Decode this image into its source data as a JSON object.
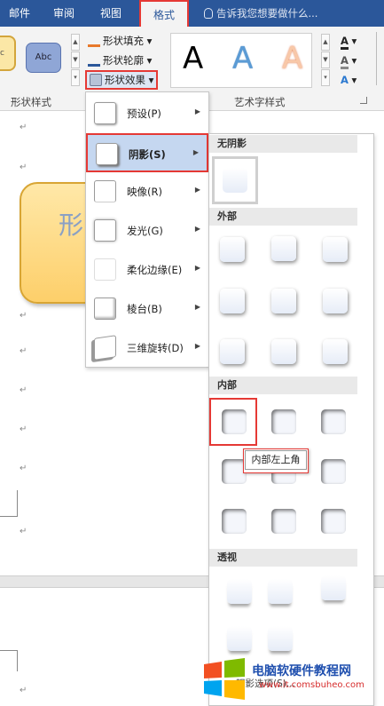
{
  "tabs": [
    {
      "label": "邮件"
    },
    {
      "label": "审阅"
    },
    {
      "label": "视图"
    },
    {
      "label": "格式"
    }
  ],
  "tellme": "告诉我您想要做什么...",
  "ribbon": {
    "style_sample": "Abc",
    "fill": "形状填充",
    "outline": "形状轮廓",
    "effects": "形状效果",
    "shape_styles_label": "形状样式",
    "wordart_label": "艺术字样式",
    "wordart_letter": "A"
  },
  "document": {
    "shape_text": "形"
  },
  "effects_menu": [
    {
      "label": "预设(P)"
    },
    {
      "label": "阴影(S)"
    },
    {
      "label": "映像(R)"
    },
    {
      "label": "发光(G)"
    },
    {
      "label": "柔化边缘(E)"
    },
    {
      "label": "棱台(B)"
    },
    {
      "label": "三维旋转(D)"
    }
  ],
  "gallery": {
    "no_shadow": "无阴影",
    "outer": "外部",
    "inner": "内部",
    "perspective": "透视",
    "tooltip": "内部左上角",
    "more": "阴影选项(S)..."
  },
  "watermark": {
    "title": "电脑软硬件教程网",
    "url": "www.it.comsbuheo.com"
  },
  "colors": {
    "accent": "#2b579a",
    "highlight": "#e53935",
    "selected": "#c5d7f0"
  }
}
